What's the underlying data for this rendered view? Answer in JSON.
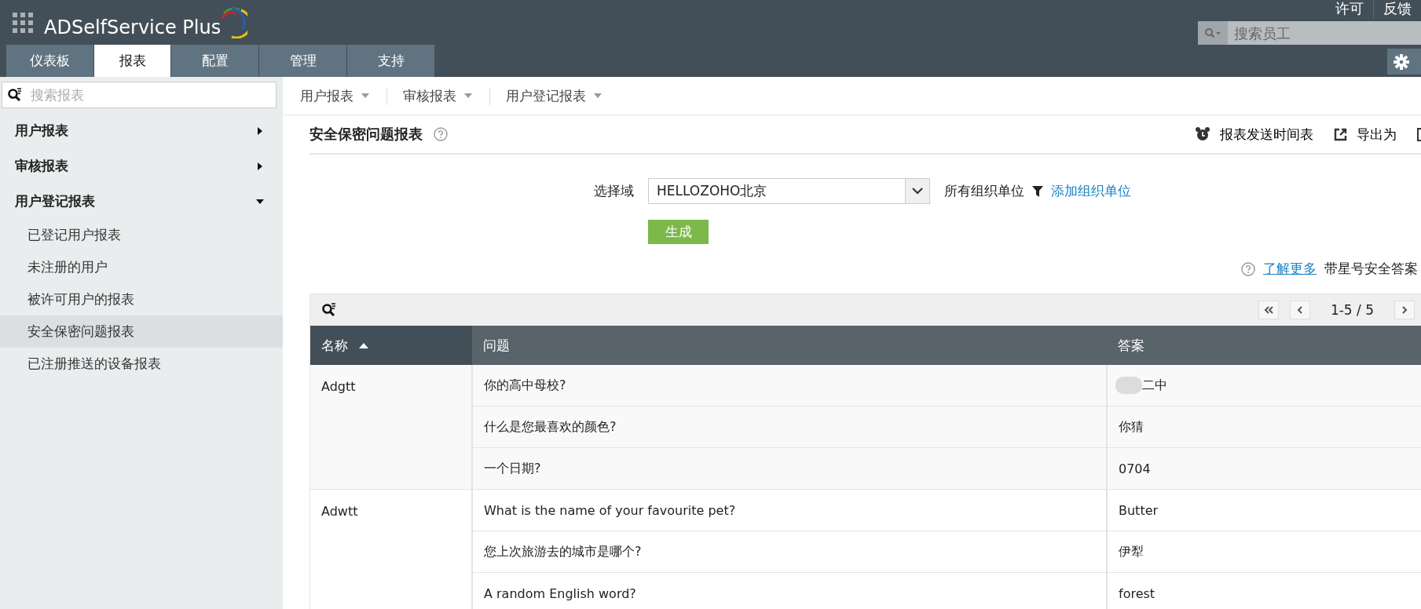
{
  "header": {
    "product_name": "ADSelfService Plus",
    "top_links": [
      "许可",
      "反馈"
    ],
    "search": {
      "placeholder": "搜索员工"
    }
  },
  "tabs": [
    {
      "label": "仪表板",
      "selected": false
    },
    {
      "label": "报表",
      "selected": true
    },
    {
      "label": "配置",
      "selected": false
    },
    {
      "label": "管理",
      "selected": false
    },
    {
      "label": "支持",
      "selected": false
    }
  ],
  "sidebar": {
    "search": {
      "placeholder": "搜索报表"
    },
    "sections": [
      {
        "label": "用户报表",
        "expanded": false
      },
      {
        "label": "审核报表",
        "expanded": false
      },
      {
        "label": "用户登记报表",
        "expanded": true,
        "children": [
          {
            "label": "已登记用户报表",
            "selected": false
          },
          {
            "label": "未注册的用户",
            "selected": false
          },
          {
            "label": "被许可用户的报表",
            "selected": false
          },
          {
            "label": "安全保密问题报表",
            "selected": true
          },
          {
            "label": "已注册推送的设备报表",
            "selected": false
          }
        ]
      }
    ]
  },
  "sub_nav": [
    "用户报表",
    "审核报表",
    "用户登记报表"
  ],
  "report": {
    "title": "安全保密问题报表",
    "actions": [
      "报表发送时间表",
      "导出为"
    ],
    "domain_label": "选择域",
    "domain_value": "HELLOZOHO北京",
    "ou_label": "所有组织单位",
    "add_ou_link": "添加组织单位",
    "generate_button": "生成",
    "info_link": "了解更多",
    "info_text": "带星号安全答案"
  },
  "table": {
    "pager": "1-5 / 5",
    "columns": [
      {
        "label": "名称",
        "sorted": true
      },
      {
        "label": "问题",
        "sorted": false
      },
      {
        "label": "答案",
        "sorted": false
      }
    ],
    "groups": [
      {
        "name": "Adgtt",
        "rows": [
          {
            "question": "你的高中母校?",
            "answer": "二中",
            "redacted": true
          },
          {
            "question": "什么是您最喜欢的颜色?",
            "answer": "你猜",
            "redacted": false
          },
          {
            "question": "一个日期?",
            "answer": "0704",
            "redacted": false
          }
        ]
      },
      {
        "name": "Adwtt",
        "rows": [
          {
            "question": "What is the name of your favourite pet?",
            "answer": "Butter",
            "redacted": false
          },
          {
            "question": "您上次旅游去的城市是哪个?",
            "answer": "伊犁",
            "redacted": false
          },
          {
            "question": "A random English word?",
            "answer": "forest",
            "redacted": false
          }
        ]
      }
    ]
  }
}
